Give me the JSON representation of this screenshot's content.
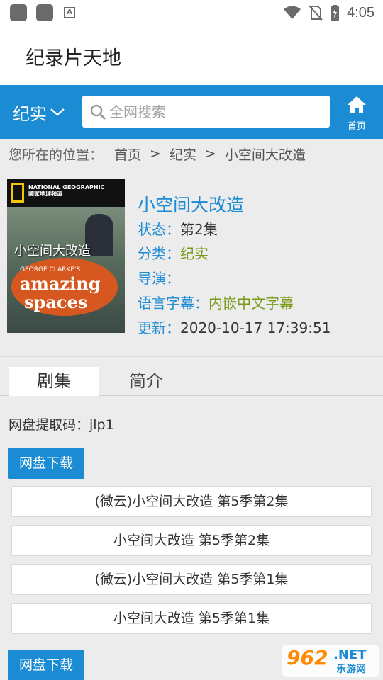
{
  "status_bar": {
    "time": "4:05",
    "icons": [
      "notification-icon",
      "notification-icon",
      "a-icon",
      "wifi-icon",
      "no-sim-icon",
      "battery-charging-icon"
    ]
  },
  "app": {
    "title": "纪录片天地"
  },
  "nav": {
    "category": "纪实",
    "search_placeholder": "全网搜索",
    "home_label": "首页"
  },
  "breadcrumb": {
    "prefix": "您所在的位置：",
    "items": [
      "首页",
      "纪实",
      "小空间大改造"
    ]
  },
  "show": {
    "poster": {
      "brand": "NATIONAL GEOGRAPHIC",
      "brand_cn": "國家地理頻道",
      "title_cn": "小空间大改造",
      "title_line1": "GEORGE CLARKE'S",
      "title_line2": "amazing",
      "title_line3": "spaces"
    },
    "title": "小空间大改造",
    "status_label": "状态：",
    "status_value": "第2集",
    "category_label": "分类：",
    "category_value": "纪实",
    "director_label": "导演：",
    "director_value": "",
    "subtitle_label": "语言字幕：",
    "subtitle_value": "内嵌中文字幕",
    "updated_label": "更新：",
    "updated_value": "2020-10-17 17:39:51"
  },
  "tabs": [
    {
      "label": "剧集",
      "active": true
    },
    {
      "label": "简介",
      "active": false
    }
  ],
  "extraction_code": "网盘提取码：jlp1",
  "download_button_label": "网盘下载",
  "episodes": [
    "(微云)小空间大改造 第5季第2集",
    "小空间大改造 第5季第2集",
    "(微云)小空间大改造 第5季第1集",
    "小空间大改造 第5季第1集"
  ],
  "download_button_label_2": "网盘下载",
  "watermark": {
    "number": "962",
    "net": ".NET",
    "cn": "乐游网"
  },
  "colors": {
    "accent": "#1b8bd4",
    "green_value": "#7b9a1a",
    "background": "#ececec"
  }
}
